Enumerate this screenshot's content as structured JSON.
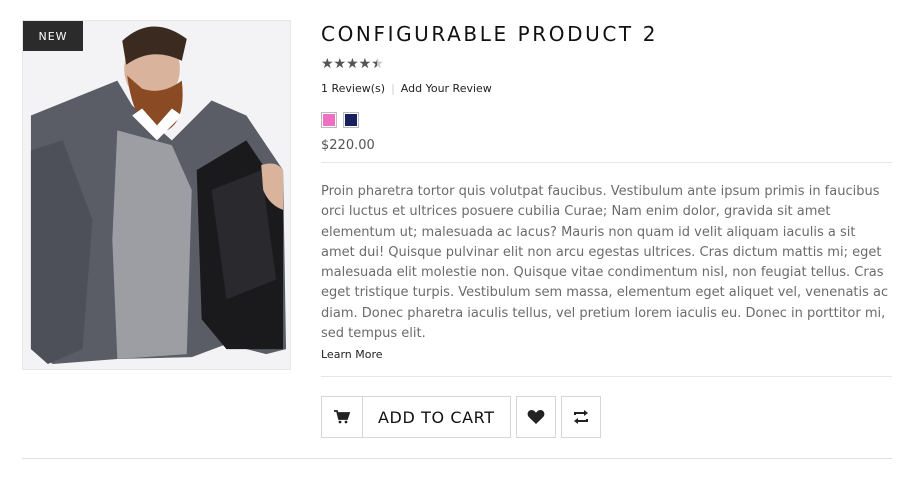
{
  "product": {
    "badge": "NEW",
    "title": "CONFIGURABLE PRODUCT 2",
    "rating_fraction": 0.8,
    "stars_glyphs": "★★★★★",
    "reviews_label": "1 Review(s)",
    "add_review_label": "Add Your Review",
    "swatches": [
      {
        "name": "pink",
        "color": "#ef6fc3"
      },
      {
        "name": "navy",
        "color": "#16205e"
      }
    ],
    "price": "$220.00",
    "description": "Proin pharetra tortor quis volutpat faucibus. Vestibulum ante ipsum primis in faucibus orci luctus et ultrices posuere cubilia Curae; Nam enim dolor, gravida sit amet elementum ut; malesuada ac lacus? Mauris non quam id velit aliquam iaculis a sit amet dui! Quisque pulvinar elit non arcu egestas ultrices. Cras dictum mattis mi; eget malesuada elit molestie non. Quisque vitae condimentum nisl, non feugiat tellus. Cras eget tristique turpis. Vestibulum sem massa, elementum eget aliquet vel, venenatis ac diam. Donec pharetra iaculis tellus, vel pretium lorem iaculis eu. Donec in porttitor mi, sed tempus elit.",
    "learn_more": "Learn More"
  },
  "actions": {
    "add_to_cart": "ADD TO CART",
    "cart_icon": "cart-icon",
    "wishlist_icon": "heart-icon",
    "compare_icon": "compare-icon"
  }
}
